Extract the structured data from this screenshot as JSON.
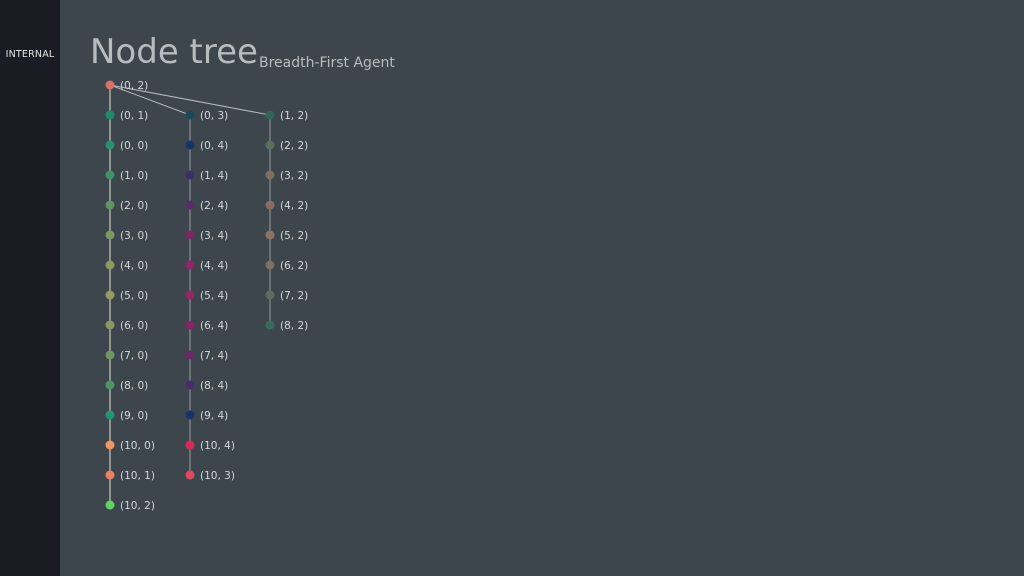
{
  "sidebar": {
    "label": "INTERNAL"
  },
  "header": {
    "title": "Node tree",
    "subtitle": "Breadth-First Agent"
  },
  "tree": {
    "root": {
      "label": "(0, 2)",
      "color": "#d8706b"
    },
    "columns": [
      {
        "children_of_root": true,
        "nodes": [
          {
            "label": "(0, 1)",
            "color": "#1f8a6a"
          },
          {
            "label": "(0, 0)",
            "color": "#25936d"
          },
          {
            "label": "(1, 0)",
            "color": "#3e9169"
          },
          {
            "label": "(2, 0)",
            "color": "#5e9462"
          },
          {
            "label": "(3, 0)",
            "color": "#7b9a5f"
          },
          {
            "label": "(4, 0)",
            "color": "#8c9a5f"
          },
          {
            "label": "(5, 0)",
            "color": "#969b63"
          },
          {
            "label": "(6, 0)",
            "color": "#889860"
          },
          {
            "label": "(7, 0)",
            "color": "#6f9760"
          },
          {
            "label": "(8, 0)",
            "color": "#4e9464"
          },
          {
            "label": "(9, 0)",
            "color": "#259470"
          },
          {
            "label": "(10, 0)",
            "color": "#f09660"
          },
          {
            "label": "(10, 1)",
            "color": "#ec8060"
          },
          {
            "label": "(10, 2)",
            "color": "#5ed45e"
          }
        ]
      },
      {
        "children_of_root": true,
        "nodes": [
          {
            "label": "(0, 3)",
            "color": "#1a4a5a"
          },
          {
            "label": "(0, 4)",
            "color": "#173566"
          },
          {
            "label": "(1, 4)",
            "color": "#3a2f68"
          },
          {
            "label": "(2, 4)",
            "color": "#5c2a66"
          },
          {
            "label": "(3, 4)",
            "color": "#7a2766"
          },
          {
            "label": "(4, 4)",
            "color": "#8e2565"
          },
          {
            "label": "(5, 4)",
            "color": "#962564"
          },
          {
            "label": "(6, 4)",
            "color": "#862565"
          },
          {
            "label": "(7, 4)",
            "color": "#6a2866"
          },
          {
            "label": "(8, 4)",
            "color": "#472d68"
          },
          {
            "label": "(9, 4)",
            "color": "#1d3266"
          },
          {
            "label": "(10, 4)",
            "color": "#d82a5a"
          },
          {
            "label": "(10, 3)",
            "color": "#e0485c"
          }
        ]
      },
      {
        "children_of_root": true,
        "nodes": [
          {
            "label": "(1, 2)",
            "color": "#2f6656"
          },
          {
            "label": "(2, 2)",
            "color": "#587060"
          },
          {
            "label": "(3, 2)",
            "color": "#787062"
          },
          {
            "label": "(4, 2)",
            "color": "#8a6c62"
          },
          {
            "label": "(5, 2)",
            "color": "#907262"
          },
          {
            "label": "(6, 2)",
            "color": "#7c6e60"
          },
          {
            "label": "(7, 2)",
            "color": "#5e6c5c"
          },
          {
            "label": "(8, 2)",
            "color": "#3a6a5a"
          }
        ]
      }
    ]
  }
}
